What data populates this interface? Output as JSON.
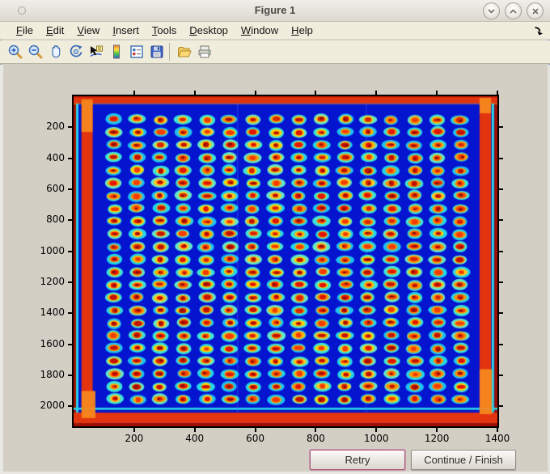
{
  "window": {
    "title": "Figure 1",
    "controls": {
      "minimize": "chevron-down",
      "maximize": "chevron-up",
      "close": "x"
    }
  },
  "menubar": {
    "items": [
      {
        "label": "File"
      },
      {
        "label": "Edit"
      },
      {
        "label": "View"
      },
      {
        "label": "Insert"
      },
      {
        "label": "Tools"
      },
      {
        "label": "Desktop"
      },
      {
        "label": "Window"
      },
      {
        "label": "Help"
      }
    ]
  },
  "toolbar": {
    "icons": [
      "zoom-in",
      "zoom-out",
      "pan",
      "rotate-3d",
      "data-cursor",
      "colorbar",
      "insert-legend",
      "save",
      "open",
      "print"
    ]
  },
  "plot": {
    "xlim": [
      0,
      1400
    ],
    "ylim": [
      0,
      2128
    ],
    "x_ticks": [
      200,
      400,
      600,
      800,
      1000,
      1200,
      1400
    ],
    "y_ticks": [
      200,
      400,
      600,
      800,
      1000,
      1200,
      1400,
      1600,
      1800,
      2000
    ],
    "image": {
      "background": "#0414cf",
      "border_red": "#e33410",
      "border_dark_red": "#9e1000",
      "border_top_dark": "#b81800",
      "border_orange": "#f5871e",
      "cyan_strip": "#2ad2e6",
      "halo_colors": [
        "#24d6e8",
        "#3ce4d8",
        "#1ec2f2",
        "#63e8c9"
      ],
      "ring_colors": [
        "#ffd000",
        "#ffb300",
        "#ff9400",
        "#ffc81e"
      ],
      "center_colors": [
        "#e11500",
        "#c41200",
        "#f53c00",
        "#d92600"
      ],
      "dark_center": "#8e0e00",
      "wells": {
        "cols": 16,
        "rows": 23,
        "x0": 134,
        "dx": 76.3,
        "y0": 150,
        "dy": 82,
        "halo_rx": 26,
        "halo_ry": 32,
        "ring_rx": 18.5,
        "ring_ry": 22.5,
        "center_rx": 11.5,
        "center_ry": 14.5
      },
      "bands": {
        "top": [
          0,
          46
        ],
        "top_dark": [
          0,
          7
        ],
        "bottom_cyan": [
          2008,
          2022
        ],
        "bottom_red": [
          2040,
          2108
        ],
        "bottom_dark": [
          2108,
          2128
        ],
        "left_dark": [
          0,
          8
        ],
        "left_cyan": [
          8,
          16
        ],
        "left_red": [
          26,
          63
        ],
        "right_red": [
          1341,
          1379
        ],
        "right_cyan": [
          1381,
          1389
        ],
        "right_dark": [
          1390,
          1400
        ]
      },
      "orange_patches": [
        [
          26,
          20,
          37,
          210
        ],
        [
          26,
          1900,
          46,
          175
        ],
        [
          1341,
          1760,
          41,
          290
        ],
        [
          1341,
          10,
          38,
          100
        ]
      ],
      "seams_x": [
        540,
        965
      ],
      "seed": 12
    }
  },
  "actions": {
    "retry": "Retry",
    "continue": "Continue / Finish"
  },
  "chart_data": {
    "type": "heatmap",
    "title": "",
    "xlabel": "",
    "ylabel": "",
    "xlim": [
      0,
      1400
    ],
    "ylim": [
      0,
      2128
    ],
    "x_ticks": [
      200,
      400,
      600,
      800,
      1000,
      1200,
      1400
    ],
    "y_ticks": [
      200,
      400,
      600,
      800,
      1000,
      1200,
      1400,
      1600,
      1800,
      2000
    ],
    "colormap": "jet",
    "description": "Jet-colormap thermal image of a microwell plate: deep blue field, hot red frame along all four edges with orange corner patches and cyan strips, and a 16x23 grid of wells, each with a red center, yellow-orange ring and cyan halo",
    "well_grid": {
      "cols": 16,
      "rows": 23,
      "x_start": 134,
      "x_step": 76.3,
      "y_start": 150,
      "y_step": 82
    }
  }
}
